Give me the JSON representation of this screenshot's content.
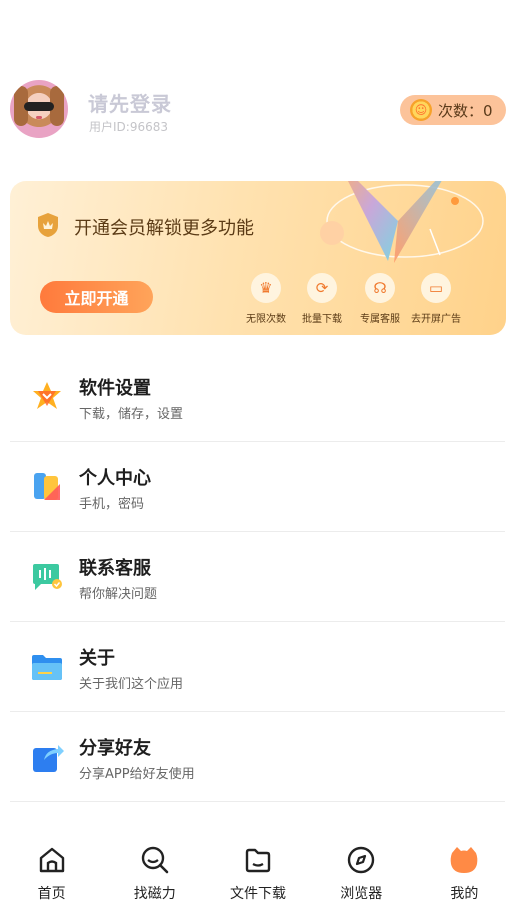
{
  "profile": {
    "login_prompt": "请先登录",
    "user_id": "用户ID:96683",
    "count_label": "次数：0"
  },
  "vip": {
    "title": "开通会员解锁更多功能",
    "button": "立即开通",
    "perks": [
      {
        "label": "无限次数",
        "icon": "crown-icon"
      },
      {
        "label": "批量下载",
        "icon": "refresh-icon"
      },
      {
        "label": "专属客服",
        "icon": "headset-icon"
      },
      {
        "label": "去开屏广告",
        "icon": "screen-icon"
      }
    ],
    "accent": "#ff7a3c"
  },
  "menu": [
    {
      "title": "软件设置",
      "subtitle": "下载，储存，设置",
      "icon": "settings-star-icon"
    },
    {
      "title": "个人中心",
      "subtitle": "手机，密码",
      "icon": "profile-card-icon"
    },
    {
      "title": "联系客服",
      "subtitle": "帮你解决问题",
      "icon": "chat-icon"
    },
    {
      "title": "关于",
      "subtitle": "关于我们这个应用",
      "icon": "folder-icon"
    },
    {
      "title": "分享好友",
      "subtitle": "分享APP给好友使用",
      "icon": "share-icon"
    }
  ],
  "tabs": [
    {
      "label": "首页",
      "icon": "home-icon"
    },
    {
      "label": "找磁力",
      "icon": "search-icon"
    },
    {
      "label": "文件下载",
      "icon": "folder-icon"
    },
    {
      "label": "浏览器",
      "icon": "compass-icon"
    },
    {
      "label": "我的",
      "icon": "cat-profile-icon",
      "active": true
    }
  ]
}
